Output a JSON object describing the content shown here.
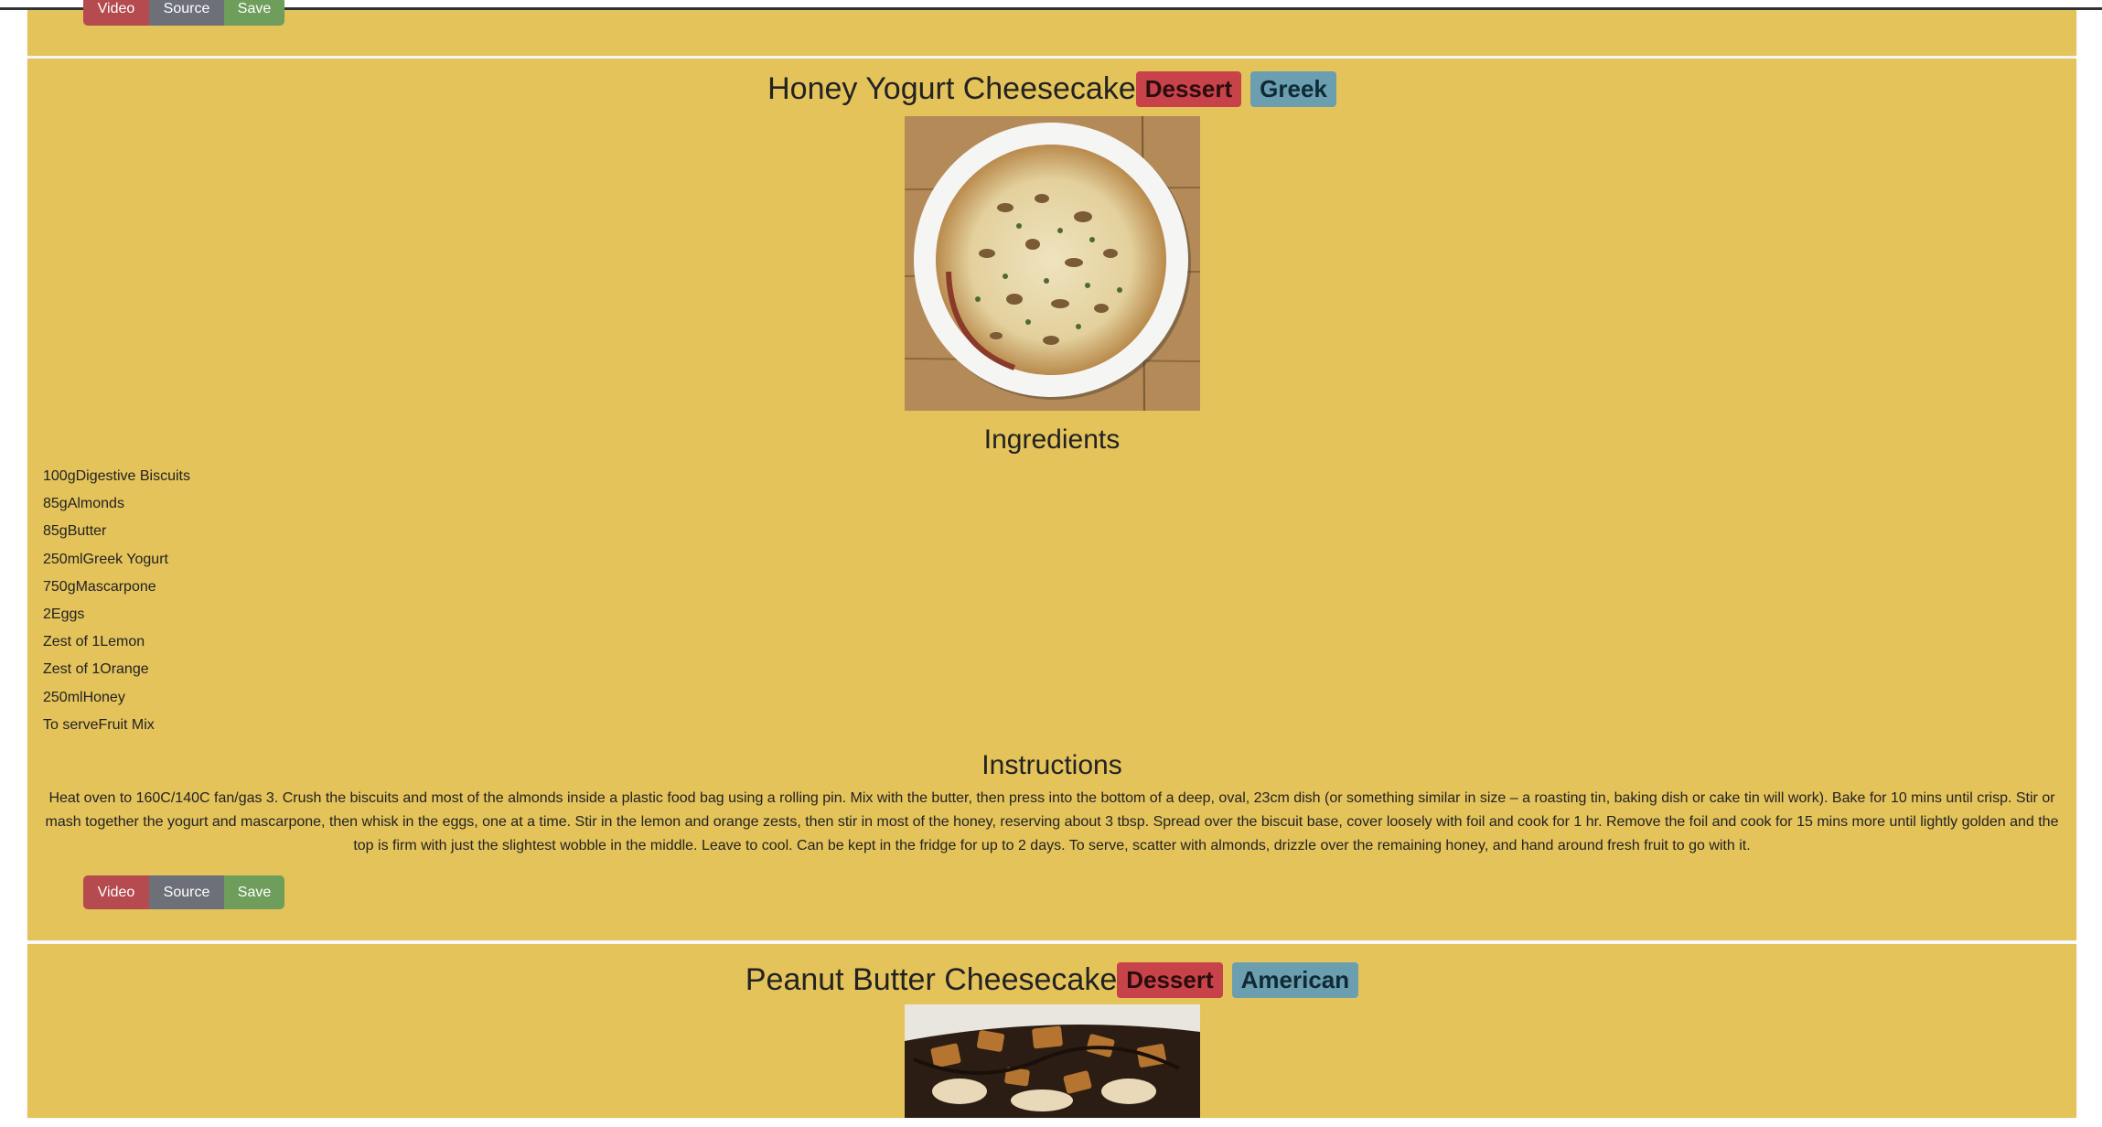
{
  "buttons": {
    "video": "Video",
    "source": "Source",
    "save": "Save"
  },
  "recipes": [
    {
      "title": "Honey Yogurt Cheesecake",
      "category": "Dessert",
      "area": "Greek",
      "ingredients_heading": "Ingredients",
      "ingredients": [
        "100gDigestive Biscuits",
        "85gAlmonds",
        "85gButter",
        "250mlGreek Yogurt",
        "750gMascarpone",
        "2Eggs",
        "Zest of 1Lemon",
        "Zest of 1Orange",
        "250mlHoney",
        "To serveFruit Mix"
      ],
      "instructions_heading": "Instructions",
      "instructions": "Heat oven to 160C/140C fan/gas 3. Crush the biscuits and most of the almonds inside a plastic food bag using a rolling pin. Mix with the butter, then press into the bottom of a deep, oval, 23cm dish (or something similar in size – a roasting tin, baking dish or cake tin will work). Bake for 10 mins until crisp. Stir or mash together the yogurt and mascarpone, then whisk in the eggs, one at a time. Stir in the lemon and orange zests, then stir in most of the honey, reserving about 3 tbsp. Spread over the biscuit base, cover loosely with foil and cook for 1 hr. Remove the foil and cook for 15 mins more until lightly golden and the top is firm with just the slightest wobble in the middle. Leave to cool. Can be kept in the fridge for up to 2 days. To serve, scatter with almonds, drizzle over the remaining honey, and hand around fresh fruit to go with it."
    },
    {
      "title": "Peanut Butter Cheesecake",
      "category": "Dessert",
      "area": "American"
    }
  ],
  "colors": {
    "card_bg": "#e4c35b",
    "video_btn": "#b54a4f",
    "source_btn": "#6e7079",
    "save_btn": "#6f9d5b",
    "category_badge": "#c8424a",
    "area_badge": "#6b9fb0"
  }
}
